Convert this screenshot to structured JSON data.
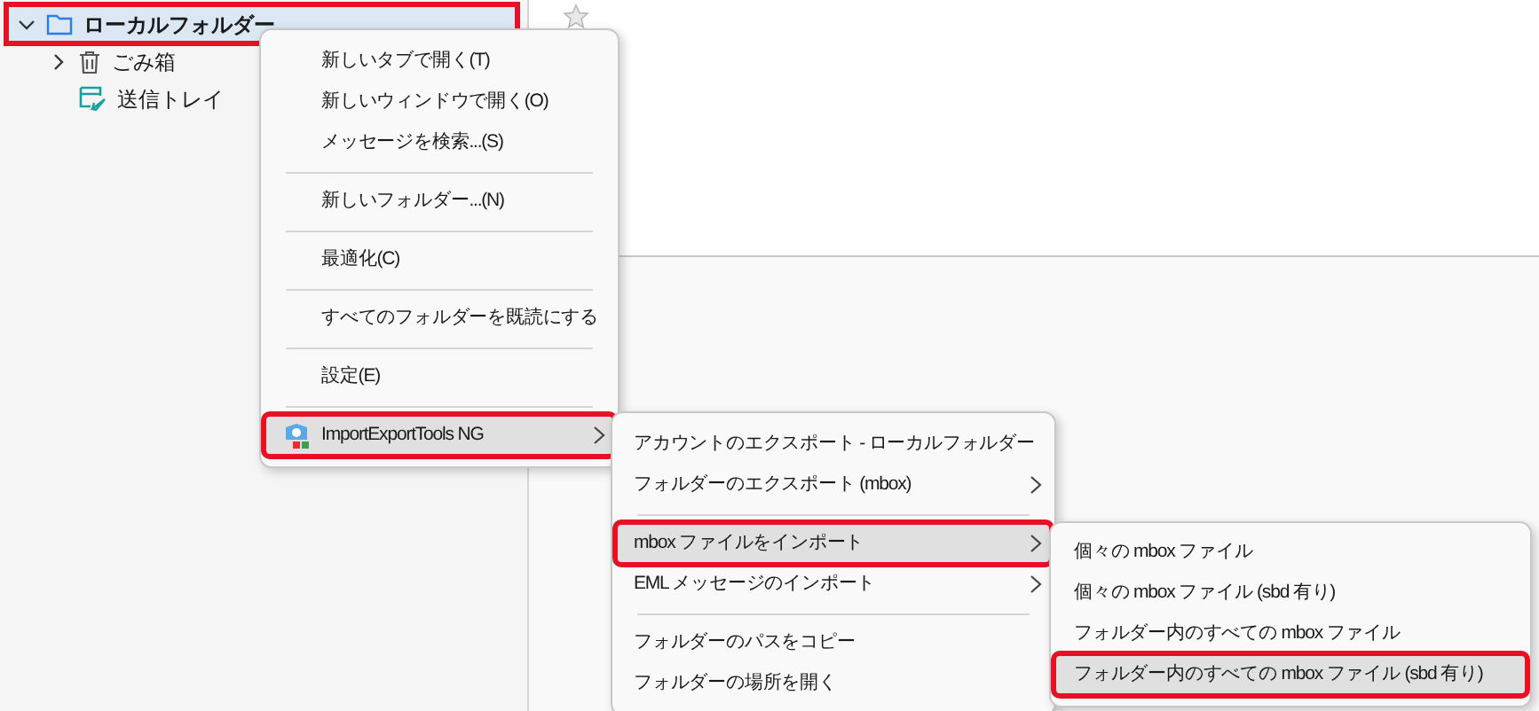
{
  "sidebar": {
    "folders": [
      {
        "label": "ローカルフォルダー",
        "expanded": true,
        "selected": true,
        "annotated": true,
        "children": [
          {
            "label": "ごみ箱",
            "expanded": false,
            "selected": false,
            "annotated": false
          },
          {
            "label": "送信トレイ",
            "selected": false,
            "annotated": false
          }
        ]
      }
    ]
  },
  "menus": [
    {
      "items": [
        {
          "kind": "item",
          "label": "新しいタブで開く(T)",
          "submenu": false,
          "selected": false,
          "annotated": false
        },
        {
          "kind": "item",
          "label": "新しいウィンドウで開く(O)",
          "submenu": false,
          "selected": false,
          "annotated": false
        },
        {
          "kind": "item",
          "label": "メッセージを検索...(S)",
          "submenu": false,
          "selected": false,
          "annotated": false
        },
        {
          "kind": "separator"
        },
        {
          "kind": "item",
          "label": "新しいフォルダー...(N)",
          "submenu": false,
          "selected": false,
          "annotated": false
        },
        {
          "kind": "separator"
        },
        {
          "kind": "item",
          "label": "最適化(C)",
          "submenu": false,
          "selected": false,
          "annotated": false
        },
        {
          "kind": "separator"
        },
        {
          "kind": "item",
          "label": "すべてのフォルダーを既読にする",
          "submenu": false,
          "selected": false,
          "annotated": false
        },
        {
          "kind": "separator"
        },
        {
          "kind": "item",
          "label": "設定(E)",
          "submenu": false,
          "selected": false,
          "annotated": false
        },
        {
          "kind": "separator"
        },
        {
          "kind": "item",
          "label": "ImportExportTools NG",
          "submenu": true,
          "selected": true,
          "annotated": true
        }
      ]
    },
    {
      "items": [
        {
          "kind": "item",
          "label": "アカウントのエクスポート - ローカルフォルダー",
          "submenu": false,
          "selected": false,
          "annotated": false
        },
        {
          "kind": "item",
          "label": "フォルダーのエクスポート (mbox)",
          "submenu": true,
          "selected": false,
          "annotated": false
        },
        {
          "kind": "separator"
        },
        {
          "kind": "item",
          "label": "mbox ファイルをインポート",
          "submenu": true,
          "selected": true,
          "annotated": true
        },
        {
          "kind": "item",
          "label": "EML メッセージのインポート",
          "submenu": true,
          "selected": false,
          "annotated": false
        },
        {
          "kind": "separator"
        },
        {
          "kind": "item",
          "label": "フォルダーのパスをコピー",
          "submenu": false,
          "selected": false,
          "annotated": false
        },
        {
          "kind": "item",
          "label": "フォルダーの場所を開く",
          "submenu": false,
          "selected": false,
          "annotated": false
        }
      ]
    },
    {
      "items": [
        {
          "kind": "item",
          "label": "個々の mbox ファイル",
          "submenu": false,
          "selected": false,
          "annotated": false
        },
        {
          "kind": "item",
          "label": "個々の mbox ファイル (sbd 有り)",
          "submenu": false,
          "selected": false,
          "annotated": false
        },
        {
          "kind": "item",
          "label": "フォルダー内のすべての mbox ファイル",
          "submenu": false,
          "selected": false,
          "annotated": false
        },
        {
          "kind": "item",
          "label": "フォルダー内のすべての mbox ファイル (sbd 有り)",
          "submenu": false,
          "selected": true,
          "annotated": true
        }
      ]
    }
  ]
}
